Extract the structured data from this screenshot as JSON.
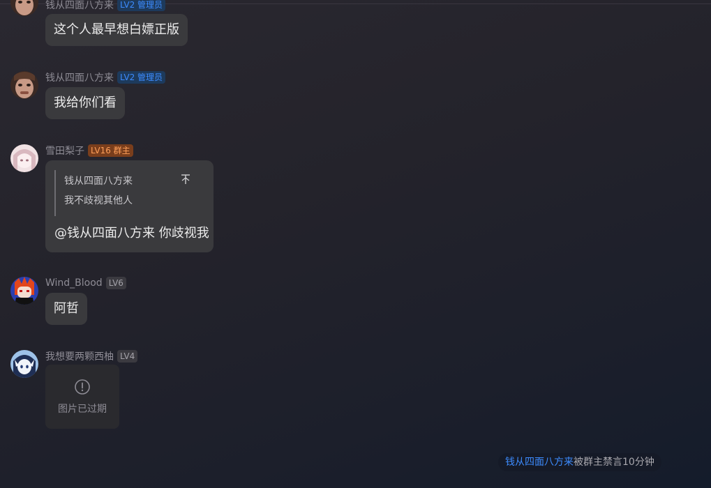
{
  "messages": [
    {
      "nickname": "钱从四面八方来",
      "badge": "LV2 管理员",
      "text": "这个人最早想白嫖正版"
    },
    {
      "nickname": "钱从四面八方来",
      "badge": "LV2 管理员",
      "text": "我给你们看"
    },
    {
      "nickname": "雪田梨子",
      "badge": "LV16 群主",
      "quote": {
        "author": "钱从四面八方来",
        "text": "我不歧视其他人"
      },
      "mention": "@钱从四面八方来",
      "text": "你歧视我"
    },
    {
      "nickname": "Wind_Blood",
      "badge": "LV6",
      "text": "阿哲"
    },
    {
      "nickname": "我想要两颗西柚",
      "badge": "LV4",
      "image_status": "图片已过期"
    }
  ],
  "system_notice": {
    "target": "钱从四面八方来",
    "text": "被群主禁言10分钟"
  },
  "colors": {
    "admin_badge_text": "#3d8cff",
    "owner_badge_text": "#ffa05a",
    "bubble_bg": "#3a3a3d",
    "link": "#3d8cff"
  },
  "icons": {
    "jump_to_quote": "arrow-up-icon",
    "expired_image": "alert-circle-icon"
  }
}
